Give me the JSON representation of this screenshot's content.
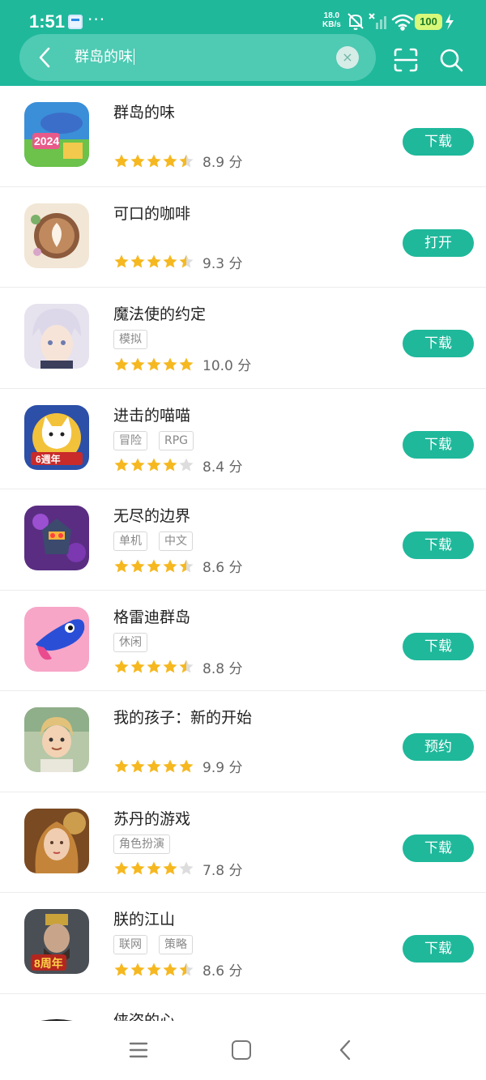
{
  "status_bar": {
    "time": "1:51",
    "dots": "···",
    "net_speed_value": "18.0",
    "net_speed_unit": "KB/s",
    "battery": "100"
  },
  "search": {
    "query": "群岛的味"
  },
  "apps": [
    {
      "name": "群岛的味",
      "tags": [],
      "stars": [
        1,
        1,
        1,
        1,
        0.5
      ],
      "score": "8.9 分",
      "action": "下载",
      "icon": "cooking-game-icon"
    },
    {
      "name": "可口的咖啡",
      "tags": [],
      "stars": [
        1,
        1,
        1,
        1,
        0.5
      ],
      "score": "9.3 分",
      "action": "打开",
      "icon": "coffee-cup-icon"
    },
    {
      "name": "魔法使的约定",
      "tags": [
        "模拟"
      ],
      "stars": [
        1,
        1,
        1,
        1,
        1
      ],
      "score": "10.0 分",
      "action": "下载",
      "icon": "anime-character-icon"
    },
    {
      "name": "进击的喵喵",
      "tags": [
        "冒险",
        "RPG"
      ],
      "stars": [
        1,
        1,
        1,
        1,
        0
      ],
      "score": "8.4 分",
      "action": "下载",
      "icon": "cat-warrior-icon"
    },
    {
      "name": "无尽的边界",
      "tags": [
        "单机",
        "中文"
      ],
      "stars": [
        1,
        1,
        1,
        1,
        0.5
      ],
      "score": "8.6 分",
      "action": "下载",
      "icon": "robot-monster-icon"
    },
    {
      "name": "格雷迪群岛",
      "tags": [
        "休闲"
      ],
      "stars": [
        1,
        1,
        1,
        1,
        0.5
      ],
      "score": "8.8 分",
      "action": "下载",
      "icon": "blue-creature-icon"
    },
    {
      "name": "我的孩子：新的开始",
      "tags": [],
      "stars": [
        1,
        1,
        1,
        1,
        1
      ],
      "score": "9.9 分",
      "action": "预约",
      "icon": "boy-portrait-icon"
    },
    {
      "name": "苏丹的游戏",
      "tags": [
        "角色扮演"
      ],
      "stars": [
        1,
        1,
        1,
        1,
        0
      ],
      "score": "7.8 分",
      "action": "下载",
      "icon": "woman-portrait-icon"
    },
    {
      "name": "朕的江山",
      "tags": [
        "联网",
        "策略"
      ],
      "stars": [
        1,
        1,
        1,
        1,
        0.5
      ],
      "score": "8.6 分",
      "action": "下载",
      "icon": "emperor-icon"
    },
    {
      "name": "侠盗的心",
      "tags": [],
      "stars": [],
      "score": "",
      "action": "",
      "icon": "rogue-mask-icon"
    }
  ],
  "colors": {
    "accent": "#1fb89b",
    "star": "#f6b820",
    "star_empty": "#dddddd"
  }
}
